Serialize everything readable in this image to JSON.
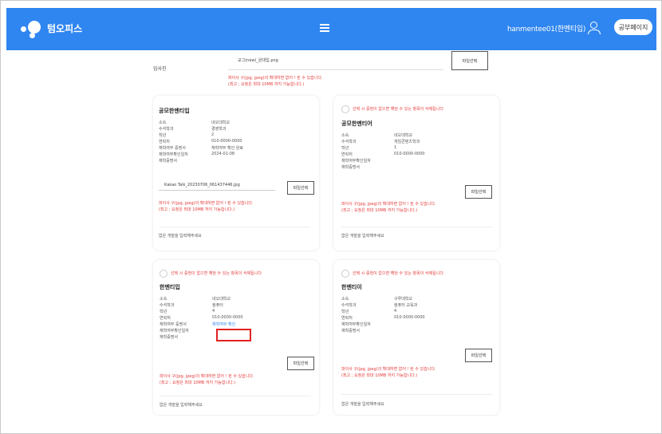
{
  "header": {
    "brand": "텀오피스",
    "username": "hanmentee01(한멘티입)",
    "action_button": "공부페이지",
    "accent_color": "#2f86f0",
    "icons": [
      "menu-icon",
      "user-icon",
      "logo-icon"
    ]
  },
  "photo": {
    "label": "입사진",
    "filename": "교그(new)_완대입.png",
    "button": "파일선택",
    "warning_lines": [
      "파이사 구(jpg, jpeg)의 확대하면 없어 ! 된 수 있습니다.",
      "(최고 ; 요청은 최대 10MB 까지 가능합니다.)"
    ]
  },
  "cards": [
    {
      "title": "공모한멘티입",
      "fields": [
        {
          "key": "소속",
          "value": "네오대학교"
        },
        {
          "key": "수석학과",
          "value": "경영학과"
        },
        {
          "key": "학년",
          "value": "2"
        },
        {
          "key": "연락처",
          "value": "010-0000-0000"
        },
        {
          "key": "재학여부 증명서",
          "value": "재학여부 확인 완료"
        },
        {
          "key": "재학여부확인일자",
          "value": "2024-01-08"
        },
        {
          "key": "재학증명서",
          "value": ""
        }
      ],
      "file_name": "Kakao Talk_20230706_061437446.jpg",
      "button": "파일선택",
      "warning_lines": [
        "파이사 구(jpg, jpeg)의 확대하면 없어 ! 된 수 있습니다.",
        "(최고 ; 요청은 최대 10MB 까지 가능합니다.)"
      ],
      "footer": "없은 개발을 입력해주세요"
    },
    {
      "title": "공모한멘티어",
      "check_warning": "선택 시 증빙이 없으면 해당 수 있는 항목이 삭제됩니다",
      "fields": [
        {
          "key": "소속",
          "value": "네오대학교"
        },
        {
          "key": "수석학과",
          "value": "게임콘텐츠학과"
        },
        {
          "key": "학년",
          "value": "1"
        },
        {
          "key": "연락처",
          "value": "010-0000-0000"
        },
        {
          "key": "재학여부확인일자",
          "value": ""
        },
        {
          "key": "재학증명서",
          "value": ""
        }
      ],
      "button": "파일선택",
      "warning_lines": [
        "파이사 구(jpg, jpeg)의 확대하면 없어 ! 된 수 있습니다.",
        "(최고 ; 요청은 최대 10MB 까지 가능합니다.)"
      ],
      "footer": "없은 개발을 입력해주세요"
    },
    {
      "title": "한멘티입",
      "check_warning": "선택 시 증빙이 없으면 해당 수 있는 항목이 삭제됩니다",
      "fields": [
        {
          "key": "소속",
          "value": "네오대학교"
        },
        {
          "key": "수석학과",
          "value": "컴퓨터"
        },
        {
          "key": "학년",
          "value": "4"
        },
        {
          "key": "연락처",
          "value": "010-0000-0000"
        },
        {
          "key": "재학여부 증명서",
          "value": "재학여부 확인"
        },
        {
          "key": "재학여부확인일자",
          "value": ""
        },
        {
          "key": "재학증명서",
          "value": ""
        }
      ],
      "button": "파일선택",
      "warning_lines": [
        "파이사 구(jpg, jpeg)의 확대하면 없어 ! 된 수 있습니다.",
        "(최고 ; 요청은 최대 10MB 까지 가능합니다.)"
      ],
      "footer": "없은 개발을 입력해주세요"
    },
    {
      "title": "한멘티이",
      "check_warning": "선택 시 증빙이 없으면 해당 수 있는 항목이 삭제됩니다",
      "fields": [
        {
          "key": "소속",
          "value": "구루대학교"
        },
        {
          "key": "수석학과",
          "value": "컴퓨터 교육과"
        },
        {
          "key": "학년",
          "value": "4"
        },
        {
          "key": "연락처",
          "value": "010-0000-0000"
        },
        {
          "key": "재학여부확인일자",
          "value": ""
        },
        {
          "key": "재학증명서",
          "value": ""
        }
      ],
      "button": "파일선택",
      "warning_lines": [
        "파이사 구(jpg, jpeg)의 확대하면 없어 ! 된 수 있습니다.",
        "(최고 ; 요청은 최대 10MB 까지 가능합니다.)"
      ],
      "footer": "없은 개발을 입력해주세요"
    }
  ]
}
